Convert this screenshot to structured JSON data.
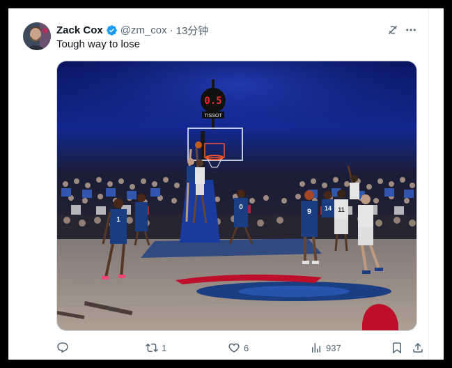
{
  "tweet": {
    "author_name": "Zack Cox",
    "handle": "@zm_cox",
    "separator": "·",
    "time": "13分钟",
    "text": "Tough way to lose"
  },
  "media": {
    "shot_clock": "0.5",
    "brand": "TISSOT",
    "jersey_numbers": [
      "1",
      "0",
      "9",
      "11",
      "14"
    ]
  },
  "actions": {
    "reply_count": "",
    "repost_count": "1",
    "like_count": "6",
    "views_count": "937"
  },
  "icons": {
    "verified": "verified-badge-icon",
    "grok": "grok-icon",
    "more": "more-icon",
    "reply": "reply-icon",
    "repost": "repost-icon",
    "like": "heart-icon",
    "views": "views-icon",
    "bookmark": "bookmark-icon",
    "share": "share-icon"
  },
  "colors": {
    "verified_blue": "#1d9bf0",
    "text_primary": "#0f1419",
    "text_secondary": "#536471",
    "sixers_blue": "#1d428a",
    "sixers_red": "#c8102e"
  }
}
